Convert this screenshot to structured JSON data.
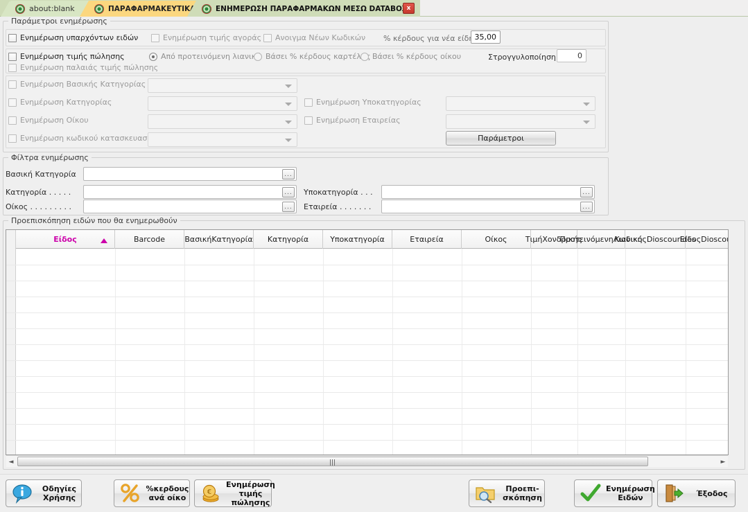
{
  "tabs": [
    {
      "label": "about:blank",
      "icon": "site-icon"
    },
    {
      "label": "ΠΑΡΑΦΑΡΜΑΚΕΥΤΙΚΑ",
      "icon": "site-icon"
    },
    {
      "label": "ΕΝΗΜΕΡΩΣΗ ΠΑΡΑΦΑΡΜΑΚΩΝ ΜΕΣΩ DATABOX",
      "icon": "site-icon"
    }
  ],
  "tab_close_label": "x",
  "update_params": {
    "title": "Παράμετροι ενημέρωσης",
    "chk_existing": "Ενημέρωση υπαρχόντων ειδών",
    "chk_purchase_price": "Ενημέρωση τιμής αγοράς",
    "chk_new_codes": "Ανοιγμα Νέων Κωδικών",
    "profit_new_label": "% κέρδους για νέα είδη .",
    "profit_new_value": "35,00",
    "chk_sale_price": "Ενημέρωση τιμής πώλησης",
    "chk_old_sale_price": "Ενημέρωση παλαιάς τιμής πώλησης",
    "radio_retail": "Από προτεινόμενη λιανική",
    "radio_card_profit": "Βάσει % κέρδους καρτέλας",
    "radio_house_profit": "Βάσει % κέρδους οίκου",
    "rounding_label": "Στρογγυλοποίηση .",
    "rounding_value": "0",
    "chk_basic_category": "Ενημέρωση Βασικής Κατηγορίας",
    "chk_category": "Ενημέρωση Κατηγορίας",
    "chk_house": "Ενημέρωση Οίκου",
    "chk_manufacturer_code": "Ενημέρωση κωδικού κατασκευαστή",
    "chk_subcategory": "Ενημέρωση Υποκατηγορίας",
    "chk_company": "Ενημέρωση Εταιρείας",
    "params_button": "Παράμετροι",
    "combo_basic_category": "",
    "combo_category": "",
    "combo_house": "",
    "combo_manufacturer_code": "",
    "combo_subcategory": "",
    "combo_company": ""
  },
  "filters": {
    "title": "Φίλτρα ενημέρωσης",
    "basic_category_label": "Βασική Κατηγορία",
    "basic_category_value": "",
    "category_label": "Κατηγορία . . . . .",
    "category_value": "",
    "house_label": "Οίκος . . . . . . . . .",
    "house_value": "",
    "subcategory_label": "Υποκατηγορία . . .",
    "subcategory_value": "",
    "company_label": "Εταιρεία . . . . . . .",
    "company_value": "",
    "browse_label": "..."
  },
  "preview": {
    "title": "Προεπισκόπηση ειδών που θα ενημερωθούν",
    "sort_column": "Είδος",
    "columns": [
      "Είδος",
      "Barcode",
      "Βασική\nΚατηγορία",
      "Κατηγορία",
      "Υποκατηγορία",
      "Εταιρεία",
      "Οίκος",
      "Τιμή\nΧονδρικής",
      "Προτεινόμενη\nΛιανική",
      "Κωδικός\nDioscourides",
      "Είδος\nDioscour"
    ],
    "rows": [],
    "scroll_left_arrow": "◄",
    "scroll_right_arrow": "►"
  },
  "footer_buttons": [
    {
      "name": "help",
      "label": "Οδηγίες\nΧρήσης",
      "icon": "info-balloon-icon"
    },
    {
      "name": "profit-per-house",
      "label": "%κερδους\nανά οίκο",
      "icon": "percent-icon"
    },
    {
      "name": "update-sale-price",
      "label": "Ενημέρωση\nτιμής πώλησης",
      "icon": "coins-icon"
    },
    {
      "name": "preview",
      "label": "Προεπι-\nσκόπηση",
      "icon": "folder-search-icon"
    },
    {
      "name": "update-items",
      "label": "Ενημέρωση\nΕιδών",
      "icon": "green-check-icon"
    },
    {
      "name": "exit",
      "label": "Έξοδος",
      "icon": "exit-door-icon"
    }
  ],
  "colors": {
    "tab_active": "#cfdcb8",
    "tab_selected": "#fbd77f",
    "sort_highlight": "#cc00aa",
    "close_button": "#c6382c"
  }
}
